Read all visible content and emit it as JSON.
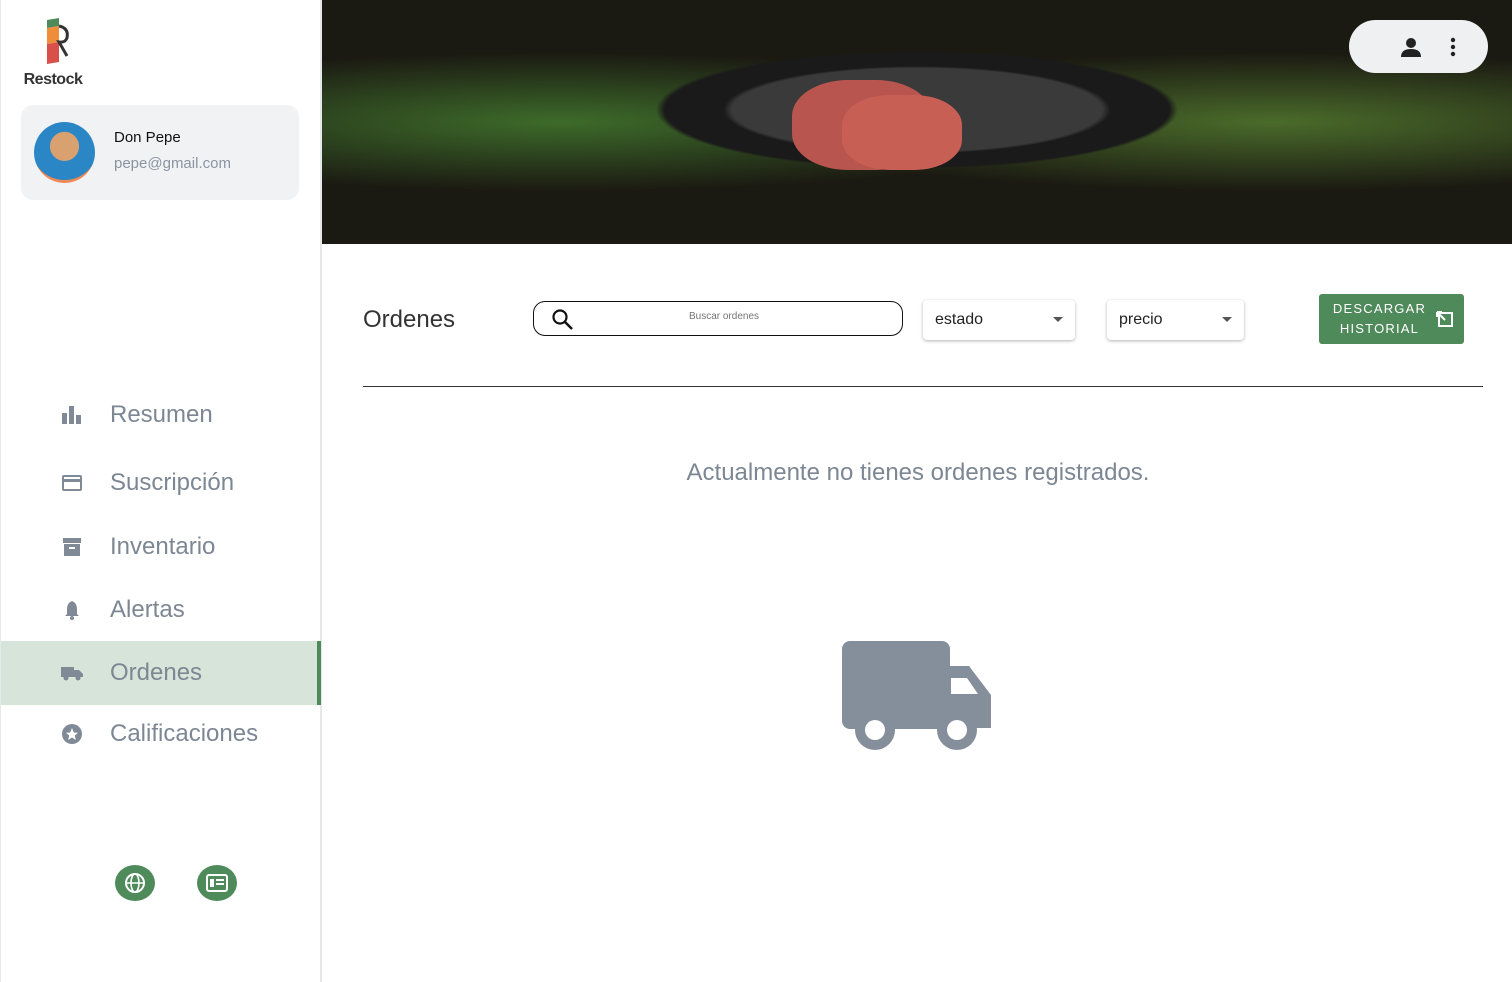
{
  "brand": {
    "name": "Restock"
  },
  "user": {
    "name": "Don Pepe",
    "email": "pepe@gmail.com"
  },
  "nav": [
    {
      "label": "Resumen",
      "icon": "bar-chart-icon"
    },
    {
      "label": "Suscripción",
      "icon": "credit-card-icon"
    },
    {
      "label": "Inventario",
      "icon": "archive-icon"
    },
    {
      "label": "Alertas",
      "icon": "bell-icon"
    },
    {
      "label": "Ordenes",
      "icon": "truck-icon",
      "active": true
    },
    {
      "label": "Calificaciones",
      "icon": "star-icon"
    }
  ],
  "main": {
    "title": "Ordenes",
    "search_placeholder": "Buscar ordenes",
    "estado": "estado",
    "precio": "precio",
    "download_line1": "DESCARGAR",
    "download_line2": "HISTORIAL",
    "empty_message": "Actualmente no tienes ordenes registrados."
  },
  "colors": {
    "accent": "#4f8a5b",
    "active_bg": "#d6e4d9",
    "muted": "#7d8794"
  }
}
